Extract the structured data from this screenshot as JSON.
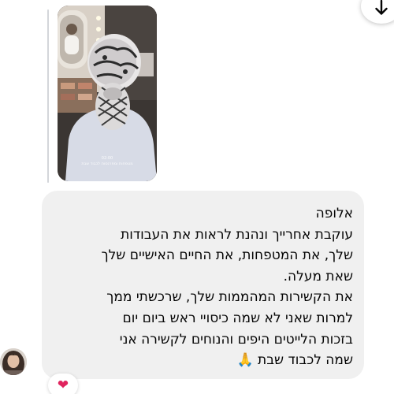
{
  "story": {
    "caption_line1": "02:00",
    "caption_line2": "מטפחות ומפרנסות לכבוד שבת"
  },
  "message": {
    "lines": [
      "אלופה",
      "עוקבת אחרייך ונהנת לראות את העבודות",
      "שלך, את המטפחות, את החיים האישיים שלך",
      "שאת מעלה.",
      "את הקשירות המהממות שלך, שרכשתי ממך",
      "למרות שאני לא שמה כיסויי ראש ביום יום",
      "בזכות הלייטים היפים והנוחים לקשירה אני",
      "שמה לכבוד שבת"
    ],
    "emoji": "🙏"
  },
  "reaction": {
    "emoji": "❤"
  },
  "icons": {
    "scroll_down": "arrow-down-icon",
    "reaction": "heart-icon",
    "emoji": "praying-hands-icon"
  },
  "colors": {
    "bubble_bg": "#f0f0f0",
    "text": "#050505",
    "reply_line": "#d4d6da",
    "heart": "#e0245e"
  }
}
